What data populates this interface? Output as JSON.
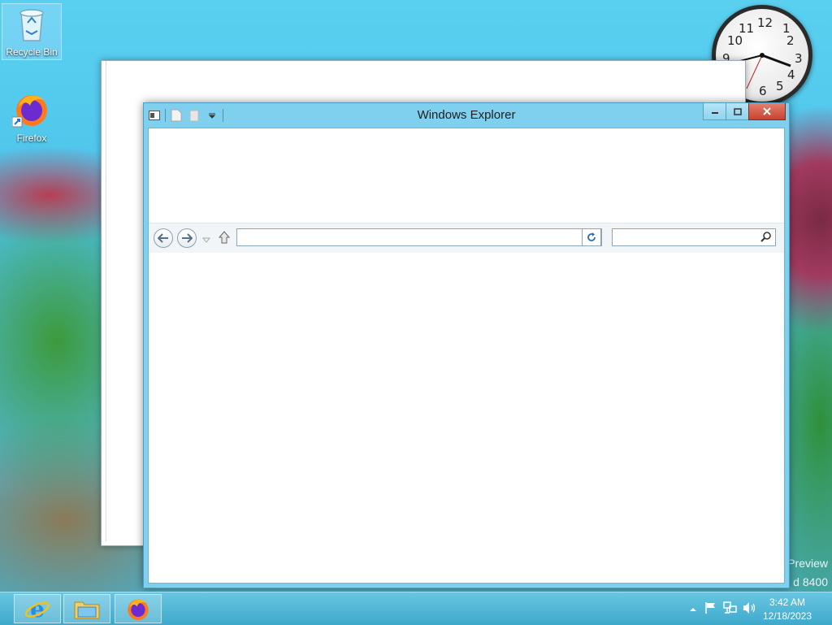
{
  "desktop": {
    "icons": [
      {
        "label": "Recycle Bin",
        "icon": "recycle-bin-icon"
      },
      {
        "label": "Firefox",
        "icon": "firefox-icon"
      }
    ],
    "watermark_line1": "Preview",
    "watermark_line2": "d 8400"
  },
  "clock": {
    "numbers": [
      "12",
      "1",
      "2",
      "3",
      "4",
      "5",
      "6",
      "9",
      "10",
      "11"
    ],
    "time_shown": "3:42"
  },
  "explorer": {
    "title": "Windows Explorer",
    "address": {
      "value": "",
      "placeholder": ""
    },
    "search": {
      "value": "",
      "placeholder": ""
    }
  },
  "taskbar": {
    "pinned": [
      {
        "name": "Internet Explorer",
        "icon": "internet-explorer-icon"
      },
      {
        "name": "File Explorer",
        "icon": "folder-icon"
      },
      {
        "name": "Firefox",
        "icon": "firefox-icon"
      }
    ],
    "tray": {
      "time": "3:42 AM",
      "date": "12/18/2023"
    }
  },
  "colors": {
    "accent": "#7fd0ee",
    "close_button": "#c7432f",
    "taskbar": "#3fa9cb"
  }
}
